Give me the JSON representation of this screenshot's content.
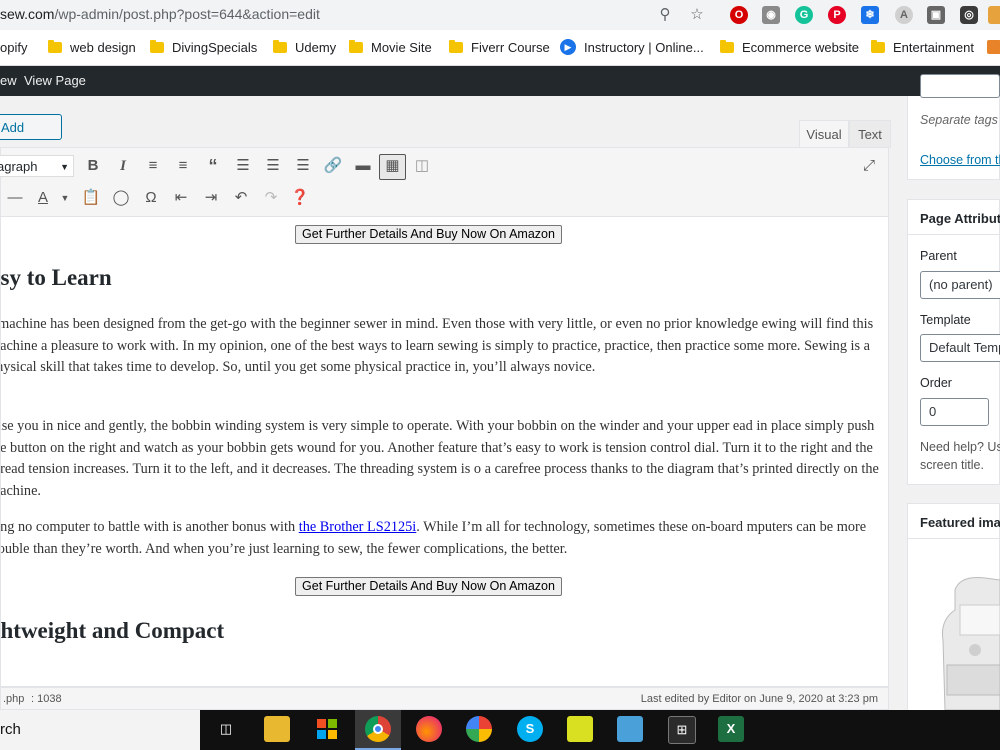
{
  "browser": {
    "url_prefix": "sew.com",
    "url_path": "/wp-admin/post.php?post=644&action=edit"
  },
  "bookmarks": [
    {
      "label": "opify"
    },
    {
      "label": "web design"
    },
    {
      "label": "DivingSpecials"
    },
    {
      "label": "Udemy"
    },
    {
      "label": "Movie Site"
    },
    {
      "label": "Fiverr Course"
    },
    {
      "label": "Instructory | Online..."
    },
    {
      "label": "Ecommerce website"
    },
    {
      "label": "Entertainment"
    }
  ],
  "adminbar": {
    "preview": "ew",
    "view_page": "View Page"
  },
  "editor": {
    "add_media": "Add Media",
    "tab_visual": "Visual",
    "tab_text": "Text",
    "format_select": "agraph",
    "amazon_button": "Get Further Details And Buy Now On Amazon",
    "heading1": "asy to Learn",
    "para1": "s machine has been designed from the get-go with the beginner sewer in mind. Even those with very little, or even no prior knowledge ewing will find this machine a pleasure to work with. In my opinion, one of the best ways to learn sewing is simply to practice, practice, then practice some more. Sewing is a physical skill that takes time to develop. So, until you get some physical practice in, you’ll always novice.",
    "para2": "ease you in nice and gently, the bobbin winding system is very simple to operate. With your bobbin on the winder and your upper ead in place simply push the button on the right and watch as your bobbin gets wound for you. Another feature that’s easy to work is tension control dial. Turn it to the right and the thread tension increases. Turn it to the left, and it decreases. The threading system is o a carefree process thanks to the diagram that’s printed directly on the machine.",
    "para3_before": "ving no computer to battle with is another bonus with ",
    "para3_link": "the Brother LS2125i",
    "para3_after": ". While I’m all for technology, sometimes these on-board mputers can be more trouble than they’re worth. And when you’re just learning to sew, the fewer complications, the better.",
    "heading2": "ghtweight and Compact",
    "footer_path": ".php",
    "footer_count": ": 1038",
    "last_edited": "Last edited by Editor on June 9, 2020 at 3:23 pm"
  },
  "sidebar": {
    "tags_hint": "Separate tags w",
    "choose_link": "Choose from th",
    "page_attributes": "Page Attribute",
    "parent_label": "Parent",
    "parent_value": "(no parent)",
    "template_label": "Template",
    "template_value": "Default Temp",
    "order_label": "Order",
    "order_value": "0",
    "help_text1": "Need help? Use",
    "help_text2": "screen title.",
    "featured_image": "Featured imag"
  },
  "taskbar": {
    "search": "rch",
    "excel_label": "X"
  }
}
